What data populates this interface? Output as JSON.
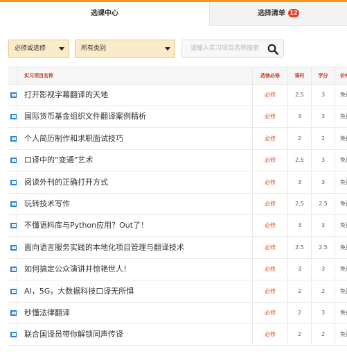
{
  "tabs": [
    {
      "label": "选课中心",
      "active": true
    },
    {
      "label": "选择清单",
      "badge": "12",
      "active": false
    }
  ],
  "colors": {
    "accent": "#f39a1e",
    "required_text": "#e2542b",
    "badge": "#ef3b24",
    "header_text": "#c0442a",
    "checkbox": "#2d7fd2"
  },
  "filters": {
    "required_select": "必修或选修",
    "category_select": "所有类别",
    "search_placeholder": "请输入实习项目名称搜索",
    "search_icon": "search-icon"
  },
  "table": {
    "headers": {
      "name": "实习项目名称",
      "required": "选修必修",
      "hours": "课时",
      "credit": "学分",
      "price": "价格"
    },
    "rows": [
      {
        "name": "打开影视字幕翻译的天地",
        "required": "必修",
        "hours": "2.5",
        "credit": "3",
        "price": "免费"
      },
      {
        "name": "国际货币基金组织文件翻译案例精析",
        "required": "必修",
        "hours": "3",
        "credit": "3",
        "price": "免费"
      },
      {
        "name": "个人简历制作和求职面试技巧",
        "required": "必修",
        "hours": "2",
        "credit": "2",
        "price": "免费"
      },
      {
        "name": "口译中的“变通”艺术",
        "required": "必修",
        "hours": "2.5",
        "credit": "3",
        "price": "免费"
      },
      {
        "name": "阅读外刊的正确打开方式",
        "required": "必修",
        "hours": "3",
        "credit": "3",
        "price": "免费"
      },
      {
        "name": "玩转技术写作",
        "required": "必修",
        "hours": "2.5",
        "credit": "2.5",
        "price": "免费"
      },
      {
        "name": "不懂语料库与Python应用？Out了！",
        "required": "必修",
        "hours": "3",
        "credit": "3",
        "price": "免费"
      },
      {
        "name": "面向语言服务实践的本地化项目管理与翻译技术",
        "required": "必修",
        "hours": "2.5",
        "credit": "2.5",
        "price": "免费"
      },
      {
        "name": "如何搞定公众演讲并惊艳世人！",
        "required": "必修",
        "hours": "3",
        "credit": "3",
        "price": "免费"
      },
      {
        "name": "AI，5G，大数据科技口译无所惧",
        "required": "必修",
        "hours": "2",
        "credit": "2",
        "price": "免费"
      },
      {
        "name": "秒懂法律翻译",
        "required": "必修",
        "hours": "2",
        "credit": "3",
        "price": "免费"
      },
      {
        "name": "联合国译员带你解锁同声传译",
        "required": "必修",
        "hours": "2",
        "credit": "2",
        "price": "免费"
      }
    ]
  }
}
